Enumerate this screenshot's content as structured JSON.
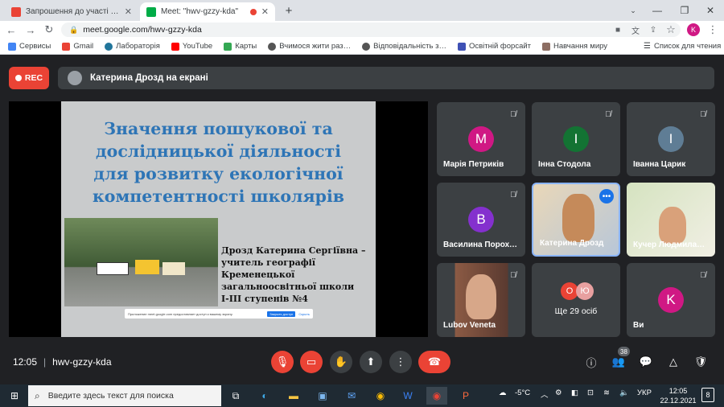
{
  "browser": {
    "tabs": [
      {
        "title": "Запрошення до участі в освітн…",
        "favicon_color": "#ea4335",
        "active": false
      },
      {
        "title": "Meet: \"hwv-gzzy-kda\"",
        "favicon_color": "#00ac47",
        "active": true
      }
    ],
    "new_tab": "+",
    "url": "meet.google.com/hwv-gzzy-kda",
    "profile_initial": "K",
    "bookmarks": [
      {
        "label": "Сервисы",
        "color": "#4285f4"
      },
      {
        "label": "Gmail",
        "color": "#ea4335"
      },
      {
        "label": "Лабораторія",
        "color": "#21759b"
      },
      {
        "label": "YouTube",
        "color": "#ff0000"
      },
      {
        "label": "Карты",
        "color": "#34a853"
      },
      {
        "label": "Вчимося жити раз…",
        "color": "#555555"
      },
      {
        "label": "Відповідальність з…",
        "color": "#555555"
      },
      {
        "label": "Освітній форсайт",
        "color": "#3f51b5"
      },
      {
        "label": "Навчання миру",
        "color": "#8d6e63"
      }
    ],
    "reading_list": "Список для чтения"
  },
  "meet": {
    "rec_label": "REC",
    "presenter_label": "Катерина Дрозд на екрані",
    "slide": {
      "title_lines": [
        "Значення пошукової та",
        "дослідницької діяльності",
        "для розвитку екологічної",
        "компетентності школярів"
      ],
      "author_lines": [
        "Дрозд Катерина Сергіївна –",
        "учитель географії",
        "Кременецької",
        "загальноосвітньої школи",
        "I-III ступенів №4"
      ],
      "share_notice": "Приложение meet.google.com предоставляет доступ к вашему экрану.",
      "share_stop": "Закрыть доступ",
      "share_hide": "Скрыть"
    },
    "participants": [
      {
        "name": "Марія Петриків",
        "initial": "М",
        "color": "#d01884"
      },
      {
        "name": "Інна Стодола",
        "initial": "І",
        "color": "#137333"
      },
      {
        "name": "Іванна Царик",
        "initial": "І",
        "color": "#5f7d95"
      },
      {
        "name": "Василина Порохо…",
        "initial": "В",
        "color": "#8430ce"
      },
      {
        "name": "Катерина Дрозд",
        "initial": "",
        "color": "#f4b400"
      },
      {
        "name": "Кучер Людмила…",
        "initial": "",
        "color": "#c58a5a"
      },
      {
        "name": "Lubov Veneta",
        "initial": "",
        "color": "#7a3b2a"
      },
      {
        "name": "Ще 29 осіб",
        "initial": "",
        "color": "#3c4043",
        "mini_avatars": [
          "О",
          "Ю"
        ]
      },
      {
        "name": "Ви",
        "initial": "K",
        "color": "#d01884"
      }
    ],
    "time": "12:05",
    "meeting_code": "hwv-gzzy-kda",
    "people_count": "38"
  },
  "taskbar": {
    "search_placeholder": "Введите здесь текст для поиска",
    "temperature": "-5°C",
    "language": "УКР",
    "clock_time": "12:05",
    "clock_date": "22.12.2021",
    "notifications": "8"
  }
}
